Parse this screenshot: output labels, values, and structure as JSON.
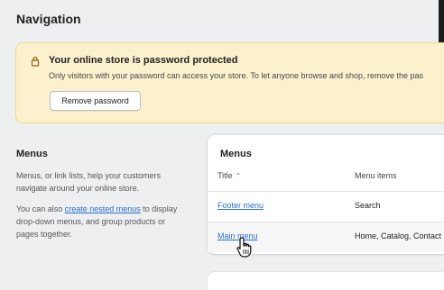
{
  "header": {
    "title": "Navigation"
  },
  "banner": {
    "icon": "lock-icon",
    "title": "Your online store is password protected",
    "text": "Only visitors with your password can access your store. To let anyone browse and shop, remove the pas",
    "button_label": "Remove password",
    "colors": {
      "background": "#fcf1cd",
      "border": "#efd891"
    }
  },
  "menus_section": {
    "heading": "Menus",
    "description": "Menus, or link lists, help your customers navigate around your online store.",
    "nested_prefix": "You can also ",
    "nested_link": "create nested menus",
    "nested_suffix": " to display drop-down menus, and group products or pages together."
  },
  "menus_card": {
    "title": "Menus",
    "columns": {
      "title": "Title",
      "items": "Menu items"
    },
    "sort_icon": "sort-icon",
    "rows": [
      {
        "title": "Footer menu",
        "items": "Search"
      },
      {
        "title": "Main menu",
        "items": "Home, Catalog, Contact"
      }
    ]
  },
  "cursor": {
    "icon": "hand-pointer-icon"
  },
  "colors": {
    "link": "#2c6ecb",
    "page_background": "#edeff0"
  }
}
